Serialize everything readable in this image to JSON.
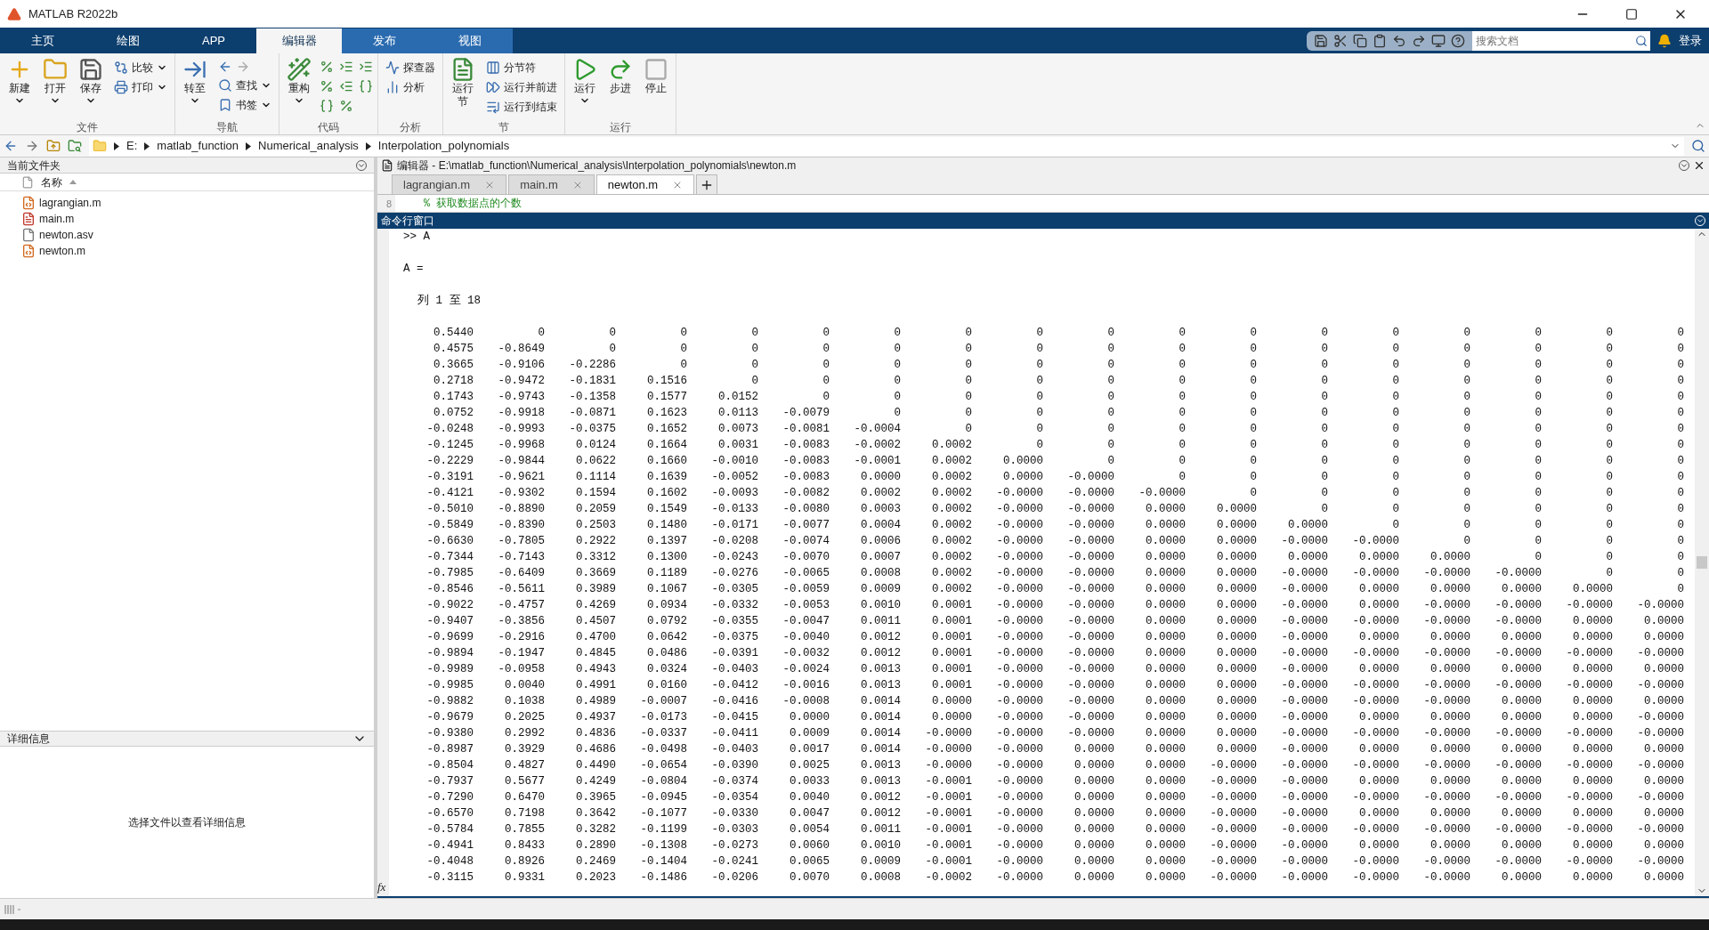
{
  "window": {
    "title": "MATLAB R2022b"
  },
  "ribbon_tabs": [
    {
      "label": "主页",
      "selected": false,
      "contextual": false
    },
    {
      "label": "绘图",
      "selected": false,
      "contextual": false
    },
    {
      "label": "APP",
      "selected": false,
      "contextual": false
    },
    {
      "label": "编辑器",
      "selected": true,
      "contextual": true
    },
    {
      "label": "发布",
      "selected": false,
      "contextual": true
    },
    {
      "label": "视图",
      "selected": false,
      "contextual": true
    }
  ],
  "search": {
    "placeholder": "搜索文档"
  },
  "login": "登录",
  "ribbon_groups": [
    {
      "label": "文件",
      "items": [
        {
          "kind": "large",
          "label": "新建",
          "dropdown": true
        },
        {
          "kind": "large",
          "label": "打开",
          "dropdown": true
        },
        {
          "kind": "large",
          "label": "保存",
          "dropdown": true
        },
        {
          "kind": "stack",
          "tools": [
            {
              "kind": "small",
              "label": "比较",
              "dropdown": true
            },
            {
              "kind": "small",
              "label": "打印",
              "dropdown": true
            }
          ]
        }
      ]
    },
    {
      "label": "导航",
      "items": [
        {
          "kind": "large",
          "label": "转至",
          "dropdown": true
        },
        {
          "kind": "stack",
          "tools": [
            {
              "kind": "pair"
            },
            {
              "kind": "small",
              "label": "查找",
              "dropdown": true
            },
            {
              "kind": "small",
              "label": "书签",
              "dropdown": true
            }
          ]
        }
      ]
    },
    {
      "label": "代码",
      "items": [
        {
          "kind": "large",
          "label": "重构",
          "dropdown": true
        },
        {
          "kind": "grid",
          "tools": [
            {
              "kind": "icon"
            },
            {
              "kind": "icon"
            },
            {
              "kind": "icon"
            },
            {
              "kind": "icon"
            },
            {
              "kind": "icon"
            },
            {
              "kind": "icon"
            },
            {
              "kind": "icon"
            },
            {
              "kind": "icon"
            }
          ]
        }
      ]
    },
    {
      "label": "分析",
      "items": [
        {
          "kind": "stack",
          "tools": [
            {
              "kind": "small",
              "label": "探查器",
              "dropdown": false
            },
            {
              "kind": "small",
              "label": "分析",
              "dropdown": false
            }
          ]
        }
      ]
    },
    {
      "label": "节",
      "items": [
        {
          "kind": "large",
          "label": "运行节",
          "dropdown": false
        },
        {
          "kind": "stack",
          "tools": [
            {
              "kind": "small",
              "label": "分节符",
              "dropdown": false
            },
            {
              "kind": "small",
              "label": "运行并前进",
              "dropdown": false
            },
            {
              "kind": "small",
              "label": "运行到结束",
              "dropdown": false
            }
          ]
        }
      ]
    },
    {
      "label": "运行",
      "items": [
        {
          "kind": "large",
          "label": "运行",
          "dropdown": true
        },
        {
          "kind": "large",
          "label": "步进",
          "dropdown": false
        },
        {
          "kind": "large",
          "label": "停止",
          "dropdown": false
        }
      ]
    }
  ],
  "address_bar": {
    "path": [
      "E:",
      "matlab_function",
      "Numerical_analysis",
      "Interpolation_polynomials"
    ]
  },
  "current_folder": {
    "title": "当前文件夹",
    "column": "名称",
    "files": [
      {
        "name": "lagrangian.m",
        "kind": "function"
      },
      {
        "name": "main.m",
        "kind": "script"
      },
      {
        "name": "newton.asv",
        "kind": "file"
      },
      {
        "name": "newton.m",
        "kind": "function"
      }
    ]
  },
  "details": {
    "title": "详细信息",
    "message": "选择文件以查看详细信息"
  },
  "editor": {
    "title": "编辑器 - E:\\matlab_function\\Numerical_analysis\\Interpolation_polynomials\\newton.m",
    "tabs": [
      {
        "label": "lagrangian.m",
        "selected": false
      },
      {
        "label": "main.m",
        "selected": false
      },
      {
        "label": "newton.m",
        "selected": true
      }
    ],
    "line_number": "8",
    "code_line": "% 获取数据点的个数"
  },
  "command_window": {
    "title": "命令行窗口",
    "prompt": ">> A",
    "variable": "A =",
    "column_range": "列 1 至 18",
    "fx_label": "fx",
    "rows": [
      [
        "0.5440",
        "0",
        "0",
        "0",
        "0",
        "0",
        "0",
        "0",
        "0",
        "0",
        "0",
        "0",
        "0",
        "0",
        "0",
        "0",
        "0",
        "0"
      ],
      [
        "0.4575",
        "-0.8649",
        "0",
        "0",
        "0",
        "0",
        "0",
        "0",
        "0",
        "0",
        "0",
        "0",
        "0",
        "0",
        "0",
        "0",
        "0",
        "0"
      ],
      [
        "0.3665",
        "-0.9106",
        "-0.2286",
        "0",
        "0",
        "0",
        "0",
        "0",
        "0",
        "0",
        "0",
        "0",
        "0",
        "0",
        "0",
        "0",
        "0",
        "0"
      ],
      [
        "0.2718",
        "-0.9472",
        "-0.1831",
        "0.1516",
        "0",
        "0",
        "0",
        "0",
        "0",
        "0",
        "0",
        "0",
        "0",
        "0",
        "0",
        "0",
        "0",
        "0"
      ],
      [
        "0.1743",
        "-0.9743",
        "-0.1358",
        "0.1577",
        "0.0152",
        "0",
        "0",
        "0",
        "0",
        "0",
        "0",
        "0",
        "0",
        "0",
        "0",
        "0",
        "0",
        "0"
      ],
      [
        "0.0752",
        "-0.9918",
        "-0.0871",
        "0.1623",
        "0.0113",
        "-0.0079",
        "0",
        "0",
        "0",
        "0",
        "0",
        "0",
        "0",
        "0",
        "0",
        "0",
        "0",
        "0"
      ],
      [
        "-0.0248",
        "-0.9993",
        "-0.0375",
        "0.1652",
        "0.0073",
        "-0.0081",
        "-0.0004",
        "0",
        "0",
        "0",
        "0",
        "0",
        "0",
        "0",
        "0",
        "0",
        "0",
        "0"
      ],
      [
        "-0.1245",
        "-0.9968",
        "0.0124",
        "0.1664",
        "0.0031",
        "-0.0083",
        "-0.0002",
        "0.0002",
        "0",
        "0",
        "0",
        "0",
        "0",
        "0",
        "0",
        "0",
        "0",
        "0"
      ],
      [
        "-0.2229",
        "-0.9844",
        "0.0622",
        "0.1660",
        "-0.0010",
        "-0.0083",
        "-0.0001",
        "0.0002",
        "0.0000",
        "0",
        "0",
        "0",
        "0",
        "0",
        "0",
        "0",
        "0",
        "0"
      ],
      [
        "-0.3191",
        "-0.9621",
        "0.1114",
        "0.1639",
        "-0.0052",
        "-0.0083",
        "0.0000",
        "0.0002",
        "0.0000",
        "-0.0000",
        "0",
        "0",
        "0",
        "0",
        "0",
        "0",
        "0",
        "0"
      ],
      [
        "-0.4121",
        "-0.9302",
        "0.1594",
        "0.1602",
        "-0.0093",
        "-0.0082",
        "0.0002",
        "0.0002",
        "-0.0000",
        "-0.0000",
        "-0.0000",
        "0",
        "0",
        "0",
        "0",
        "0",
        "0",
        "0"
      ],
      [
        "-0.5010",
        "-0.8890",
        "0.2059",
        "0.1549",
        "-0.0133",
        "-0.0080",
        "0.0003",
        "0.0002",
        "-0.0000",
        "-0.0000",
        "0.0000",
        "0.0000",
        "0",
        "0",
        "0",
        "0",
        "0",
        "0"
      ],
      [
        "-0.5849",
        "-0.8390",
        "0.2503",
        "0.1480",
        "-0.0171",
        "-0.0077",
        "0.0004",
        "0.0002",
        "-0.0000",
        "-0.0000",
        "0.0000",
        "0.0000",
        "0.0000",
        "0",
        "0",
        "0",
        "0",
        "0"
      ],
      [
        "-0.6630",
        "-0.7805",
        "0.2922",
        "0.1397",
        "-0.0208",
        "-0.0074",
        "0.0006",
        "0.0002",
        "-0.0000",
        "-0.0000",
        "0.0000",
        "0.0000",
        "-0.0000",
        "-0.0000",
        "0",
        "0",
        "0",
        "0"
      ],
      [
        "-0.7344",
        "-0.7143",
        "0.3312",
        "0.1300",
        "-0.0243",
        "-0.0070",
        "0.0007",
        "0.0002",
        "-0.0000",
        "-0.0000",
        "0.0000",
        "0.0000",
        "0.0000",
        "0.0000",
        "0.0000",
        "0",
        "0",
        "0"
      ],
      [
        "-0.7985",
        "-0.6409",
        "0.3669",
        "0.1189",
        "-0.0276",
        "-0.0065",
        "0.0008",
        "0.0002",
        "-0.0000",
        "-0.0000",
        "0.0000",
        "0.0000",
        "-0.0000",
        "-0.0000",
        "-0.0000",
        "-0.0000",
        "0",
        "0"
      ],
      [
        "-0.8546",
        "-0.5611",
        "0.3989",
        "0.1067",
        "-0.0305",
        "-0.0059",
        "0.0009",
        "0.0002",
        "-0.0000",
        "-0.0000",
        "0.0000",
        "0.0000",
        "-0.0000",
        "0.0000",
        "0.0000",
        "0.0000",
        "0.0000",
        "0"
      ],
      [
        "-0.9022",
        "-0.4757",
        "0.4269",
        "0.0934",
        "-0.0332",
        "-0.0053",
        "0.0010",
        "0.0001",
        "-0.0000",
        "-0.0000",
        "0.0000",
        "0.0000",
        "-0.0000",
        "0.0000",
        "-0.0000",
        "-0.0000",
        "-0.0000",
        "-0.0000"
      ],
      [
        "-0.9407",
        "-0.3856",
        "0.4507",
        "0.0792",
        "-0.0355",
        "-0.0047",
        "0.0011",
        "0.0001",
        "-0.0000",
        "-0.0000",
        "0.0000",
        "0.0000",
        "-0.0000",
        "-0.0000",
        "-0.0000",
        "-0.0000",
        "0.0000",
        "0.0000"
      ],
      [
        "-0.9699",
        "-0.2916",
        "0.4700",
        "0.0642",
        "-0.0375",
        "-0.0040",
        "0.0012",
        "0.0001",
        "-0.0000",
        "-0.0000",
        "0.0000",
        "0.0000",
        "-0.0000",
        "0.0000",
        "0.0000",
        "0.0000",
        "0.0000",
        "0.0000"
      ],
      [
        "-0.9894",
        "-0.1947",
        "0.4845",
        "0.0486",
        "-0.0391",
        "-0.0032",
        "0.0012",
        "0.0001",
        "-0.0000",
        "-0.0000",
        "0.0000",
        "0.0000",
        "-0.0000",
        "-0.0000",
        "-0.0000",
        "-0.0000",
        "-0.0000",
        "-0.0000"
      ],
      [
        "-0.9989",
        "-0.0958",
        "0.4943",
        "0.0324",
        "-0.0403",
        "-0.0024",
        "0.0013",
        "0.0001",
        "-0.0000",
        "-0.0000",
        "0.0000",
        "0.0000",
        "-0.0000",
        "0.0000",
        "0.0000",
        "0.0000",
        "0.0000",
        "0.0000"
      ],
      [
        "-0.9985",
        "0.0040",
        "0.4991",
        "0.0160",
        "-0.0412",
        "-0.0016",
        "0.0013",
        "0.0001",
        "-0.0000",
        "-0.0000",
        "0.0000",
        "0.0000",
        "-0.0000",
        "-0.0000",
        "-0.0000",
        "-0.0000",
        "-0.0000",
        "-0.0000"
      ],
      [
        "-0.9882",
        "0.1038",
        "0.4989",
        "-0.0007",
        "-0.0416",
        "-0.0008",
        "0.0014",
        "0.0000",
        "-0.0000",
        "-0.0000",
        "0.0000",
        "0.0000",
        "-0.0000",
        "-0.0000",
        "-0.0000",
        "0.0000",
        "0.0000",
        "0.0000"
      ],
      [
        "-0.9679",
        "0.2025",
        "0.4937",
        "-0.0173",
        "-0.0415",
        "0.0000",
        "0.0014",
        "0.0000",
        "-0.0000",
        "-0.0000",
        "0.0000",
        "0.0000",
        "-0.0000",
        "0.0000",
        "0.0000",
        "0.0000",
        "0.0000",
        "-0.0000"
      ],
      [
        "-0.9380",
        "0.2992",
        "0.4836",
        "-0.0337",
        "-0.0411",
        "0.0009",
        "0.0014",
        "-0.0000",
        "-0.0000",
        "-0.0000",
        "0.0000",
        "0.0000",
        "-0.0000",
        "-0.0000",
        "-0.0000",
        "-0.0000",
        "-0.0000",
        "-0.0000"
      ],
      [
        "-0.8987",
        "0.3929",
        "0.4686",
        "-0.0498",
        "-0.0403",
        "0.0017",
        "0.0014",
        "-0.0000",
        "-0.0000",
        "0.0000",
        "0.0000",
        "0.0000",
        "-0.0000",
        "0.0000",
        "0.0000",
        "0.0000",
        "0.0000",
        "0.0000"
      ],
      [
        "-0.8504",
        "0.4827",
        "0.4490",
        "-0.0654",
        "-0.0390",
        "0.0025",
        "0.0013",
        "-0.0000",
        "-0.0000",
        "0.0000",
        "0.0000",
        "-0.0000",
        "-0.0000",
        "-0.0000",
        "-0.0000",
        "-0.0000",
        "-0.0000",
        "-0.0000"
      ],
      [
        "-0.7937",
        "0.5677",
        "0.4249",
        "-0.0804",
        "-0.0374",
        "0.0033",
        "0.0013",
        "-0.0001",
        "-0.0000",
        "0.0000",
        "0.0000",
        "-0.0000",
        "-0.0000",
        "0.0000",
        "0.0000",
        "0.0000",
        "0.0000",
        "0.0000"
      ],
      [
        "-0.7290",
        "0.6470",
        "0.3965",
        "-0.0945",
        "-0.0354",
        "0.0040",
        "0.0012",
        "-0.0001",
        "-0.0000",
        "0.0000",
        "0.0000",
        "-0.0000",
        "-0.0000",
        "-0.0000",
        "-0.0000",
        "-0.0000",
        "-0.0000",
        "-0.0000"
      ],
      [
        "-0.6570",
        "0.7198",
        "0.3642",
        "-0.1077",
        "-0.0330",
        "0.0047",
        "0.0012",
        "-0.0001",
        "-0.0000",
        "0.0000",
        "0.0000",
        "-0.0000",
        "-0.0000",
        "0.0000",
        "0.0000",
        "0.0000",
        "0.0000",
        "0.0000"
      ],
      [
        "-0.5784",
        "0.7855",
        "0.3282",
        "-0.1199",
        "-0.0303",
        "0.0054",
        "0.0011",
        "-0.0001",
        "-0.0000",
        "0.0000",
        "0.0000",
        "-0.0000",
        "-0.0000",
        "-0.0000",
        "-0.0000",
        "-0.0000",
        "-0.0000",
        "-0.0000"
      ],
      [
        "-0.4941",
        "0.8433",
        "0.2890",
        "-0.1308",
        "-0.0273",
        "0.0060",
        "0.0010",
        "-0.0001",
        "-0.0000",
        "0.0000",
        "0.0000",
        "-0.0000",
        "-0.0000",
        "0.0000",
        "0.0000",
        "0.0000",
        "0.0000",
        "0.0000"
      ],
      [
        "-0.4048",
        "0.8926",
        "0.2469",
        "-0.1404",
        "-0.0241",
        "0.0065",
        "0.0009",
        "-0.0001",
        "-0.0000",
        "0.0000",
        "0.0000",
        "-0.0000",
        "-0.0000",
        "-0.0000",
        "-0.0000",
        "-0.0000",
        "-0.0000",
        "-0.0000"
      ],
      [
        "-0.3115",
        "0.9331",
        "0.2023",
        "-0.1486",
        "-0.0206",
        "0.0070",
        "0.0008",
        "-0.0002",
        "-0.0000",
        "0.0000",
        "0.0000",
        "-0.0000",
        "-0.0000",
        "-0.0000",
        "-0.0000",
        "0.0000",
        "0.0000",
        "0.0000"
      ]
    ]
  }
}
